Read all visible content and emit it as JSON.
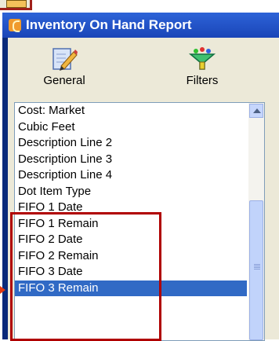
{
  "window": {
    "title": "Inventory On Hand Report"
  },
  "toolbar": {
    "general_label": "General",
    "filters_label": "Filters"
  },
  "list": {
    "items": [
      "Cost: Market",
      "Cubic Feet",
      "Description Line 2",
      "Description Line 3",
      "Description Line 4",
      "Dot Item Type",
      "FIFO 1 Date",
      "FIFO 1 Remain",
      "FIFO 2 Date",
      "FIFO 2 Remain",
      "FIFO 3 Date",
      "FIFO 3 Remain"
    ],
    "selected": "FIFO 3 Remain"
  },
  "colors": {
    "titlebar": "#1a45b8",
    "selection": "#316ac5",
    "highlight_box": "#b00000"
  },
  "icons": {
    "general": "pencil-page-icon",
    "filters": "funnel-icon"
  }
}
